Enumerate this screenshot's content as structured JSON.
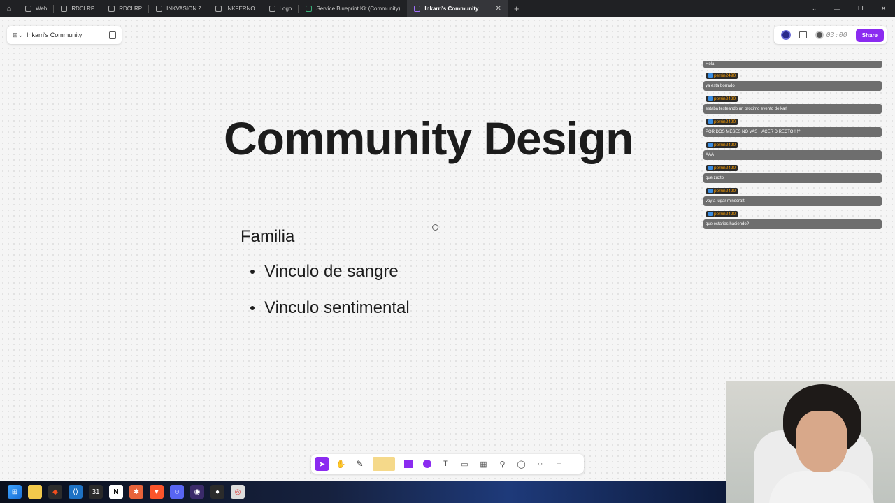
{
  "browser": {
    "tabs": [
      {
        "label": "Web",
        "active": false
      },
      {
        "label": "RDCLRP",
        "active": false
      },
      {
        "label": "RDCLRP",
        "active": false
      },
      {
        "label": "INKVASION Z",
        "active": false
      },
      {
        "label": "INKFERNO",
        "active": false
      },
      {
        "label": "Logo",
        "active": false
      },
      {
        "label": "Service Blueprint Kit (Community)",
        "active": false
      },
      {
        "label": "Inkarri's Community",
        "active": true
      }
    ],
    "close_glyph": "✕",
    "new_tab_glyph": "+"
  },
  "app": {
    "file_name": "Inkarri's Community",
    "timer": "03:00",
    "share_label": "Share",
    "accent_color": "#8b2bf0"
  },
  "canvas": {
    "title": "Community Design",
    "list_heading": "Familia",
    "bullets": [
      "Vinculo de sangre",
      "Vinculo sentimental"
    ]
  },
  "chat": {
    "partial_top": "Hola",
    "messages": [
      {
        "user": "perrin2490",
        "text": "ya esta borrado"
      },
      {
        "user": "perrin2490",
        "text": "estaba testeando un proximo evento de karl"
      },
      {
        "user": "perrin2490",
        "text": "POR DOS MESES NO VAS HACER DIRECTO!!!!?"
      },
      {
        "user": "perrin2490",
        "text": "AAA"
      },
      {
        "user": "perrin2490",
        "text": "que zuzto"
      },
      {
        "user": "perrin2490",
        "text": "voy a jugar minecraft"
      },
      {
        "user": "perrin2490",
        "text": "que estarias haciendo?"
      }
    ]
  },
  "toolbar": {
    "tools": [
      "move-tool",
      "hand-tool",
      "pencil-tool",
      "sticky-note-tool",
      "shape-tool",
      "connector-tool",
      "text-tool",
      "section-tool",
      "table-tool",
      "stamp-tool",
      "comment-tool",
      "more-tools",
      "add-tool"
    ]
  },
  "taskbar": {
    "apps": [
      "start",
      "file-explorer",
      "figma",
      "vscode",
      "calendar",
      "notion",
      "app",
      "brave",
      "discord",
      "obs",
      "obs-secondary",
      "chrome"
    ]
  }
}
